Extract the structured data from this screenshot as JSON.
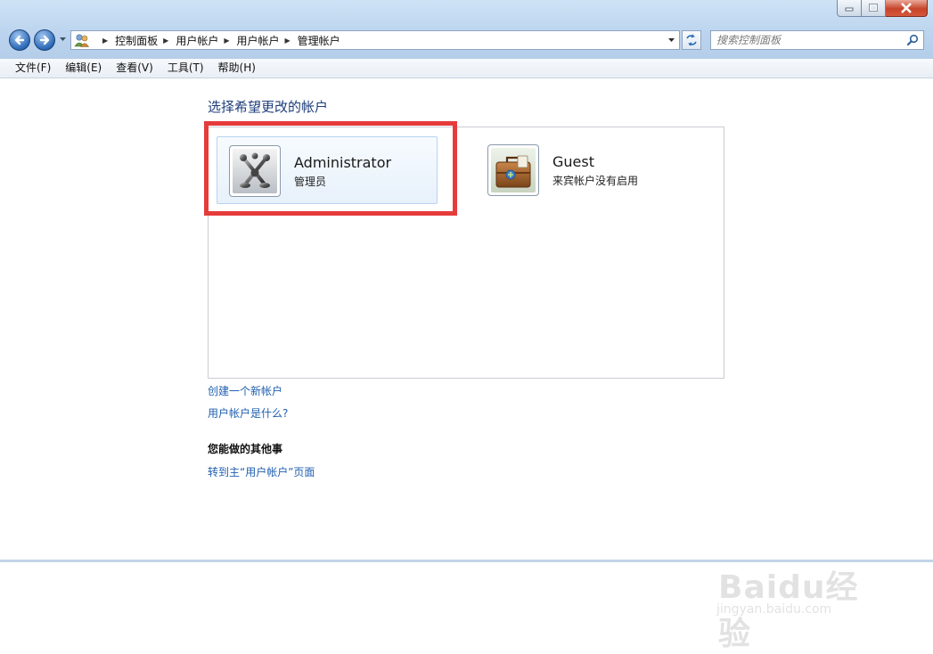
{
  "window": {
    "caption_buttons": [
      "minimize",
      "maximize",
      "close"
    ]
  },
  "address": {
    "breadcrumbs": [
      "控制面板",
      "用户帐户",
      "用户帐户",
      "管理帐户"
    ]
  },
  "search": {
    "placeholder": "搜索控制面板"
  },
  "menu": {
    "items": [
      "文件(F)",
      "编辑(E)",
      "查看(V)",
      "工具(T)",
      "帮助(H)"
    ]
  },
  "content": {
    "heading": "选择希望更改的帐户",
    "accounts": [
      {
        "name": "Administrator",
        "type": "管理员",
        "selected": true,
        "icon": "chess-pieces-avatar-icon"
      },
      {
        "name": "Guest",
        "type": "来宾帐户没有启用",
        "selected": false,
        "icon": "briefcase-avatar-icon"
      }
    ],
    "links": {
      "create_account": "创建一个新帐户",
      "what_is_account": "用户帐户是什么?"
    },
    "other_heading": "您能做的其他事",
    "go_to_main": "转到主“用户帐户”页面"
  },
  "watermark": {
    "logo_text": "Baidu经验",
    "url": "jingyan.baidu.com"
  },
  "colors": {
    "highlight_frame": "#e53b3b",
    "link": "#1f5fb0",
    "heading": "#1f3e7a"
  }
}
